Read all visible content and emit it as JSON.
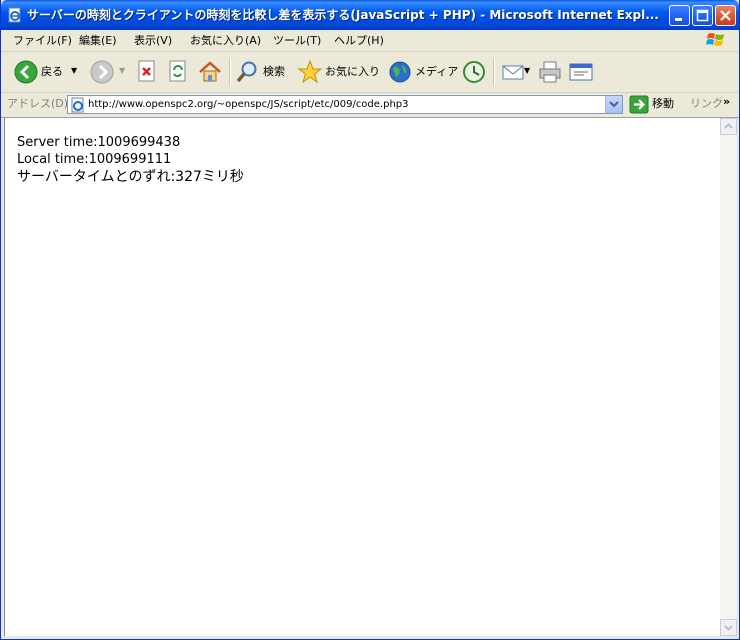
{
  "window": {
    "title": "サーバーの時刻とクライアントの時刻を比較し差を表示する(JavaScript + PHP) - Microsoft Internet Expl..."
  },
  "menu": {
    "items": [
      "ファイル(F)",
      "編集(E)",
      "表示(V)",
      "お気に入り(A)",
      "ツール(T)",
      "ヘルプ(H)"
    ]
  },
  "toolbar": {
    "back_label": "戻る",
    "search_label": "検索",
    "favorites_label": "お気に入り",
    "media_label": "メディア"
  },
  "address": {
    "label": "アドレス(D)",
    "url": "http://www.openspc2.org/~openspc/JS/script/etc/009/code.php3",
    "go_label": "移動",
    "links_label": "リンク",
    "more": "»"
  },
  "page": {
    "server_time": "Server time:1009699438",
    "local_time": "Local time:1009699111",
    "difference": "サーバータイムとのずれ:327ミリ秒"
  },
  "colors": {
    "titlebar": "#0058ee",
    "window_border": "#0831d9",
    "chrome": "#ece9d8"
  }
}
